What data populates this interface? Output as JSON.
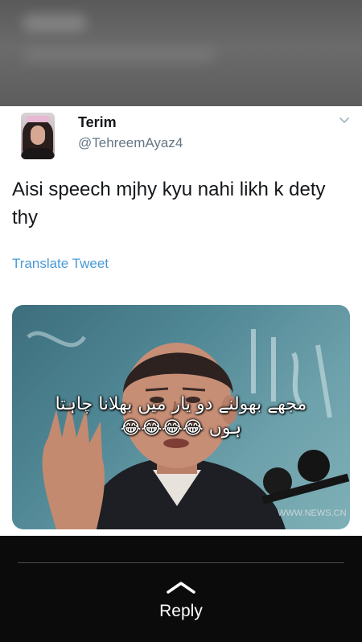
{
  "tweet": {
    "author_name": "Terim",
    "author_handle": "@TehreemAyaz4",
    "text": "Aisi speech mjhy kyu nahi likh k dety thy",
    "translate_label": "Translate Tweet",
    "media_caption_line1": "مجھے بھولنے دو یار میں بھلانا چاہتا",
    "media_caption_line2": "ہوں 😂😂😂😂",
    "media_watermark": "WWW.NEWS.CN"
  },
  "bottom_bar": {
    "reply_label": "Reply"
  },
  "colors": {
    "name": "#14171a",
    "handle": "#657786",
    "link": "#4a9ad6",
    "overlay_bg": "#0b0b0b"
  },
  "icons": {
    "avatar": "profile-photo",
    "menu": "chevron-down-icon",
    "reply": "chevron-up-icon"
  }
}
